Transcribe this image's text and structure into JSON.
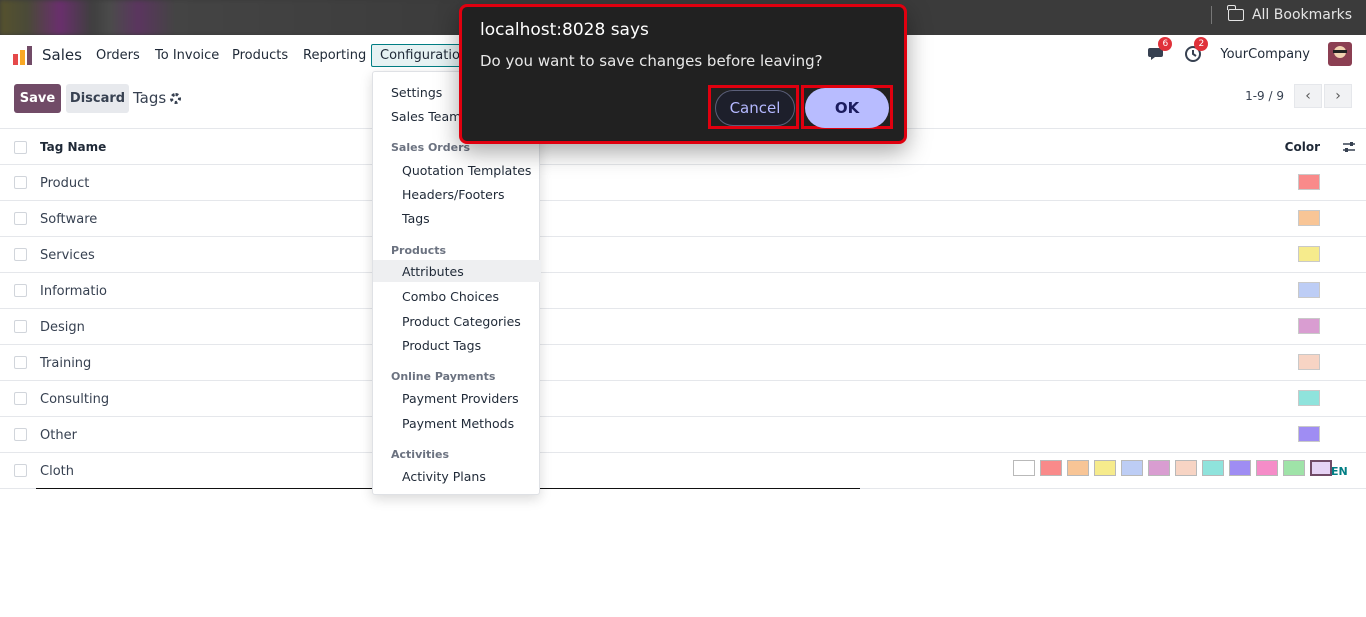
{
  "browser": {
    "bookmarks_label": "All Bookmarks"
  },
  "navbar": {
    "app_name": "Sales",
    "menu": [
      "Orders",
      "To Invoice",
      "Products",
      "Reporting"
    ],
    "config_label": "Configuration",
    "messages_count": "6",
    "activities_count": "2",
    "company": "YourCompany"
  },
  "control_panel": {
    "save_label": "Save",
    "discard_label": "Discard",
    "title": "Tags",
    "pager": "1-9 / 9"
  },
  "table": {
    "headers": {
      "name": "Tag Name",
      "color": "Color"
    },
    "rows": [
      {
        "name": "Product",
        "color": "#f98a8a"
      },
      {
        "name": "Software",
        "color": "#f8c596"
      },
      {
        "name": "Services",
        "color": "#f6eb8c"
      },
      {
        "name": "Informatio",
        "color": "#bdcdf5"
      },
      {
        "name": "Design",
        "color": "#d99dd1"
      },
      {
        "name": "Training",
        "color": "#f7d4c4"
      },
      {
        "name": "Consulting",
        "color": "#8fe3dc"
      },
      {
        "name": "Other",
        "color": "#9f8df3"
      },
      {
        "name": "Cloth",
        "color": ""
      }
    ],
    "color_picker": [
      "#ffffff",
      "#f98a8a",
      "#f8c596",
      "#f6eb8c",
      "#bdcdf5",
      "#d99dd1",
      "#f7d4c4",
      "#8fe3dc",
      "#9f8df3",
      "#f58cc8",
      "#9fe3a8",
      "#e6d3f5"
    ],
    "lang_tag": "EN"
  },
  "dropdown": {
    "settings": "Settings",
    "sales_teams": "Sales Teams",
    "section_sales_orders": "Sales Orders",
    "quotation_templates": "Quotation Templates",
    "headers_footers": "Headers/Footers",
    "tags": "Tags",
    "section_products": "Products",
    "attributes": "Attributes",
    "combo_choices": "Combo Choices",
    "product_categories": "Product Categories",
    "product_tags": "Product Tags",
    "section_online_payments": "Online Payments",
    "payment_providers": "Payment Providers",
    "payment_methods": "Payment Methods",
    "section_activities": "Activities",
    "activity_plans": "Activity Plans"
  },
  "alert": {
    "title": "localhost:8028 says",
    "message": "Do you want to save changes before leaving?",
    "cancel_label": "Cancel",
    "ok_label": "OK"
  },
  "colors": {
    "brand": "#714b67",
    "accent": "#017e84",
    "highlight": "#e0000f"
  }
}
